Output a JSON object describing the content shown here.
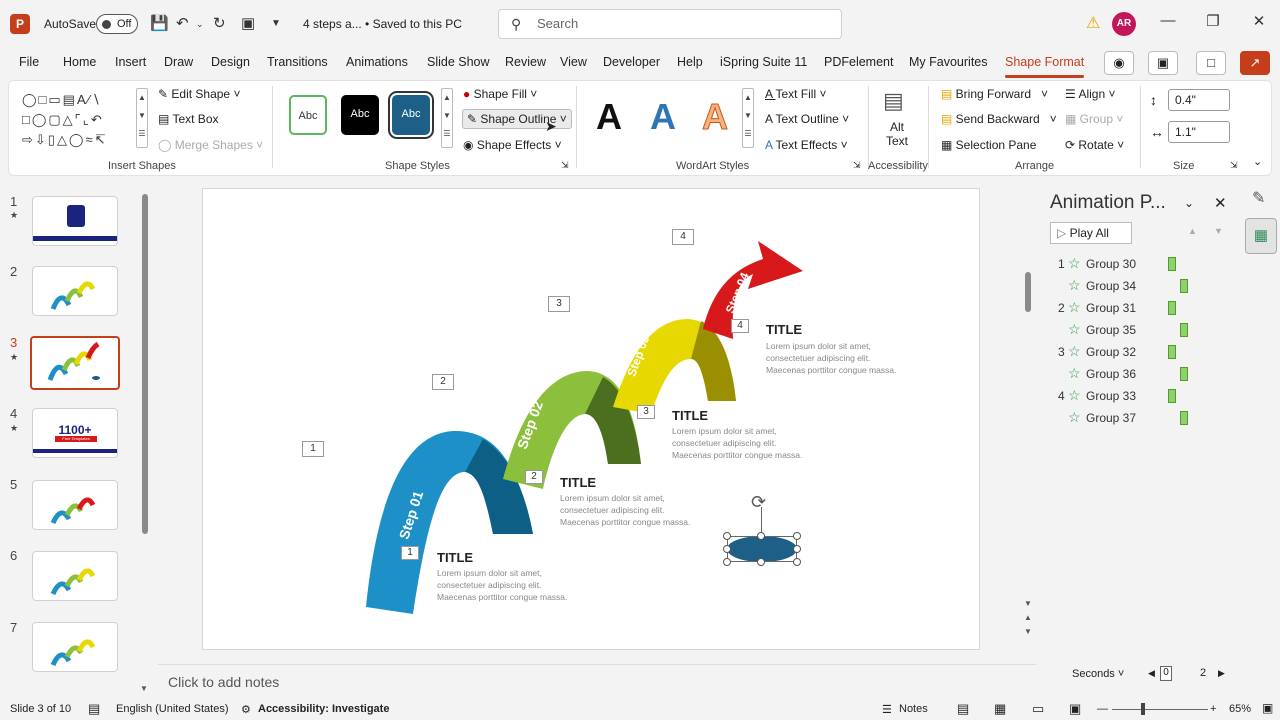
{
  "titlebar": {
    "autosave": "AutoSave",
    "toggle": "Off",
    "doc_title": "4 steps a... • Saved to this PC",
    "search_placeholder": "Search",
    "avatar": "AR"
  },
  "tabs": [
    "File",
    "Home",
    "Insert",
    "Draw",
    "Design",
    "Transitions",
    "Animations",
    "Slide Show",
    "Review",
    "View",
    "Developer",
    "Help",
    "iSpring Suite 11",
    "PDFelement",
    "My Favourites",
    "Shape Format"
  ],
  "ribbon": {
    "edit_shape": "Edit Shape",
    "text_box": "Text Box",
    "merge_shapes": "Merge Shapes",
    "insert_shapes": "Insert Shapes",
    "style_samples": [
      "Abc",
      "Abc",
      "Abc"
    ],
    "shape_fill": "Shape Fill",
    "shape_outline": "Shape Outline",
    "shape_effects": "Shape Effects",
    "shape_styles": "Shape Styles",
    "wordart_letter": "A",
    "text_fill": "Text Fill",
    "text_outline": "Text Outline",
    "text_effects": "Text Effects",
    "wordart_styles": "WordArt Styles",
    "alt_text": "Alt Text",
    "accessibility": "Accessibility",
    "bring_forward": "Bring Forward",
    "send_backward": "Send Backward",
    "selection_pane": "Selection Pane",
    "align": "Align",
    "group": "Group",
    "rotate": "Rotate",
    "arrange": "Arrange",
    "height": "0.4\"",
    "width": "1.1\"",
    "size": "Size"
  },
  "slides": {
    "numbers": [
      "1",
      "2",
      "3",
      "4",
      "5",
      "6",
      "7"
    ],
    "thumb4_text": "1100+",
    "thumb4_sub": "Free Templates"
  },
  "slide": {
    "boxes": [
      "1",
      "2",
      "3",
      "4"
    ],
    "step_labels": [
      "Step 01",
      "Step 02",
      "Step 03",
      "Step 04"
    ],
    "inner_boxes": [
      "1",
      "2",
      "3",
      "4"
    ],
    "titles": [
      "TITLE",
      "TITLE",
      "TITLE",
      "TITLE"
    ],
    "body": "Lorem ipsum dolor sit amet, consectetuer adipiscing elit. Maecenas porttitor congue massa."
  },
  "notes_placeholder": "Click to add notes",
  "animation_pane": {
    "title": "Animation P...",
    "play_all": "Play All",
    "items": [
      {
        "num": "1",
        "label": "Group 30"
      },
      {
        "num": "",
        "label": "Group 34"
      },
      {
        "num": "2",
        "label": "Group 31"
      },
      {
        "num": "",
        "label": "Group 35"
      },
      {
        "num": "3",
        "label": "Group 32"
      },
      {
        "num": "",
        "label": "Group 36"
      },
      {
        "num": "4",
        "label": "Group 33"
      },
      {
        "num": "",
        "label": "Group 37"
      }
    ],
    "seconds": "Seconds",
    "timeline_start": "0",
    "timeline_end": "2"
  },
  "status": {
    "slide_of": "Slide 3 of 10",
    "language": "English (United States)",
    "accessibility": "Accessibility: Investigate",
    "notes": "Notes",
    "zoom": "65%"
  },
  "colors": {
    "accent": "#c43e1c",
    "step1": "#1e90c8",
    "step2": "#8bbf3c",
    "step3": "#e6d800",
    "step4": "#d7191c",
    "oval": "#1d5f86"
  }
}
